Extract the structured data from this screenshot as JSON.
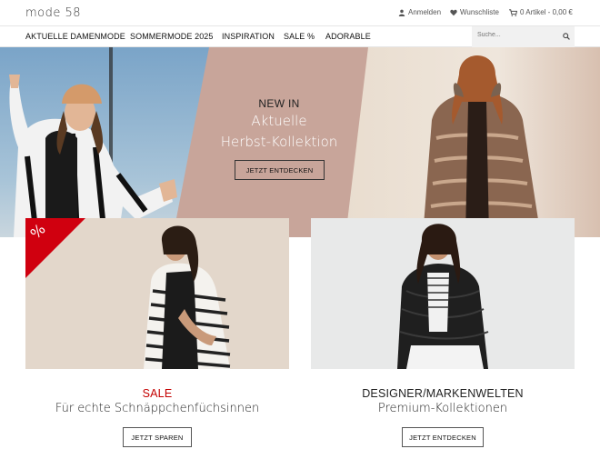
{
  "header": {
    "logo": "mode 58",
    "login": "Anmelden",
    "wishlist": "Wunschliste",
    "cart": "0 Artikel - 0,00 €"
  },
  "nav": {
    "items": [
      "AKTUELLE DAMENMODE",
      "SOMMERMODE 2025",
      "INSPIRATION",
      "SALE %",
      "ADORABLE"
    ],
    "search_placeholder": "Suche..."
  },
  "hero": {
    "kicker": "NEW IN",
    "title_line1": "Aktuelle",
    "title_line2": "Herbst-Kollektion",
    "button": "JETZT ENTDECKEN"
  },
  "tiles": {
    "sale_badge": "%",
    "left": {
      "heading": "SALE",
      "subtitle": "Für echte Schnäppchenfüchsinnen",
      "button": "JETZT SPAREN"
    },
    "right": {
      "heading": "DESIGNER/MARKENWELTEN",
      "subtitle": "Premium-Kollektionen",
      "button": "JETZT ENTDECKEN"
    }
  },
  "colors": {
    "sale_red": "#c40000",
    "hero_center": "#c8a59a"
  }
}
